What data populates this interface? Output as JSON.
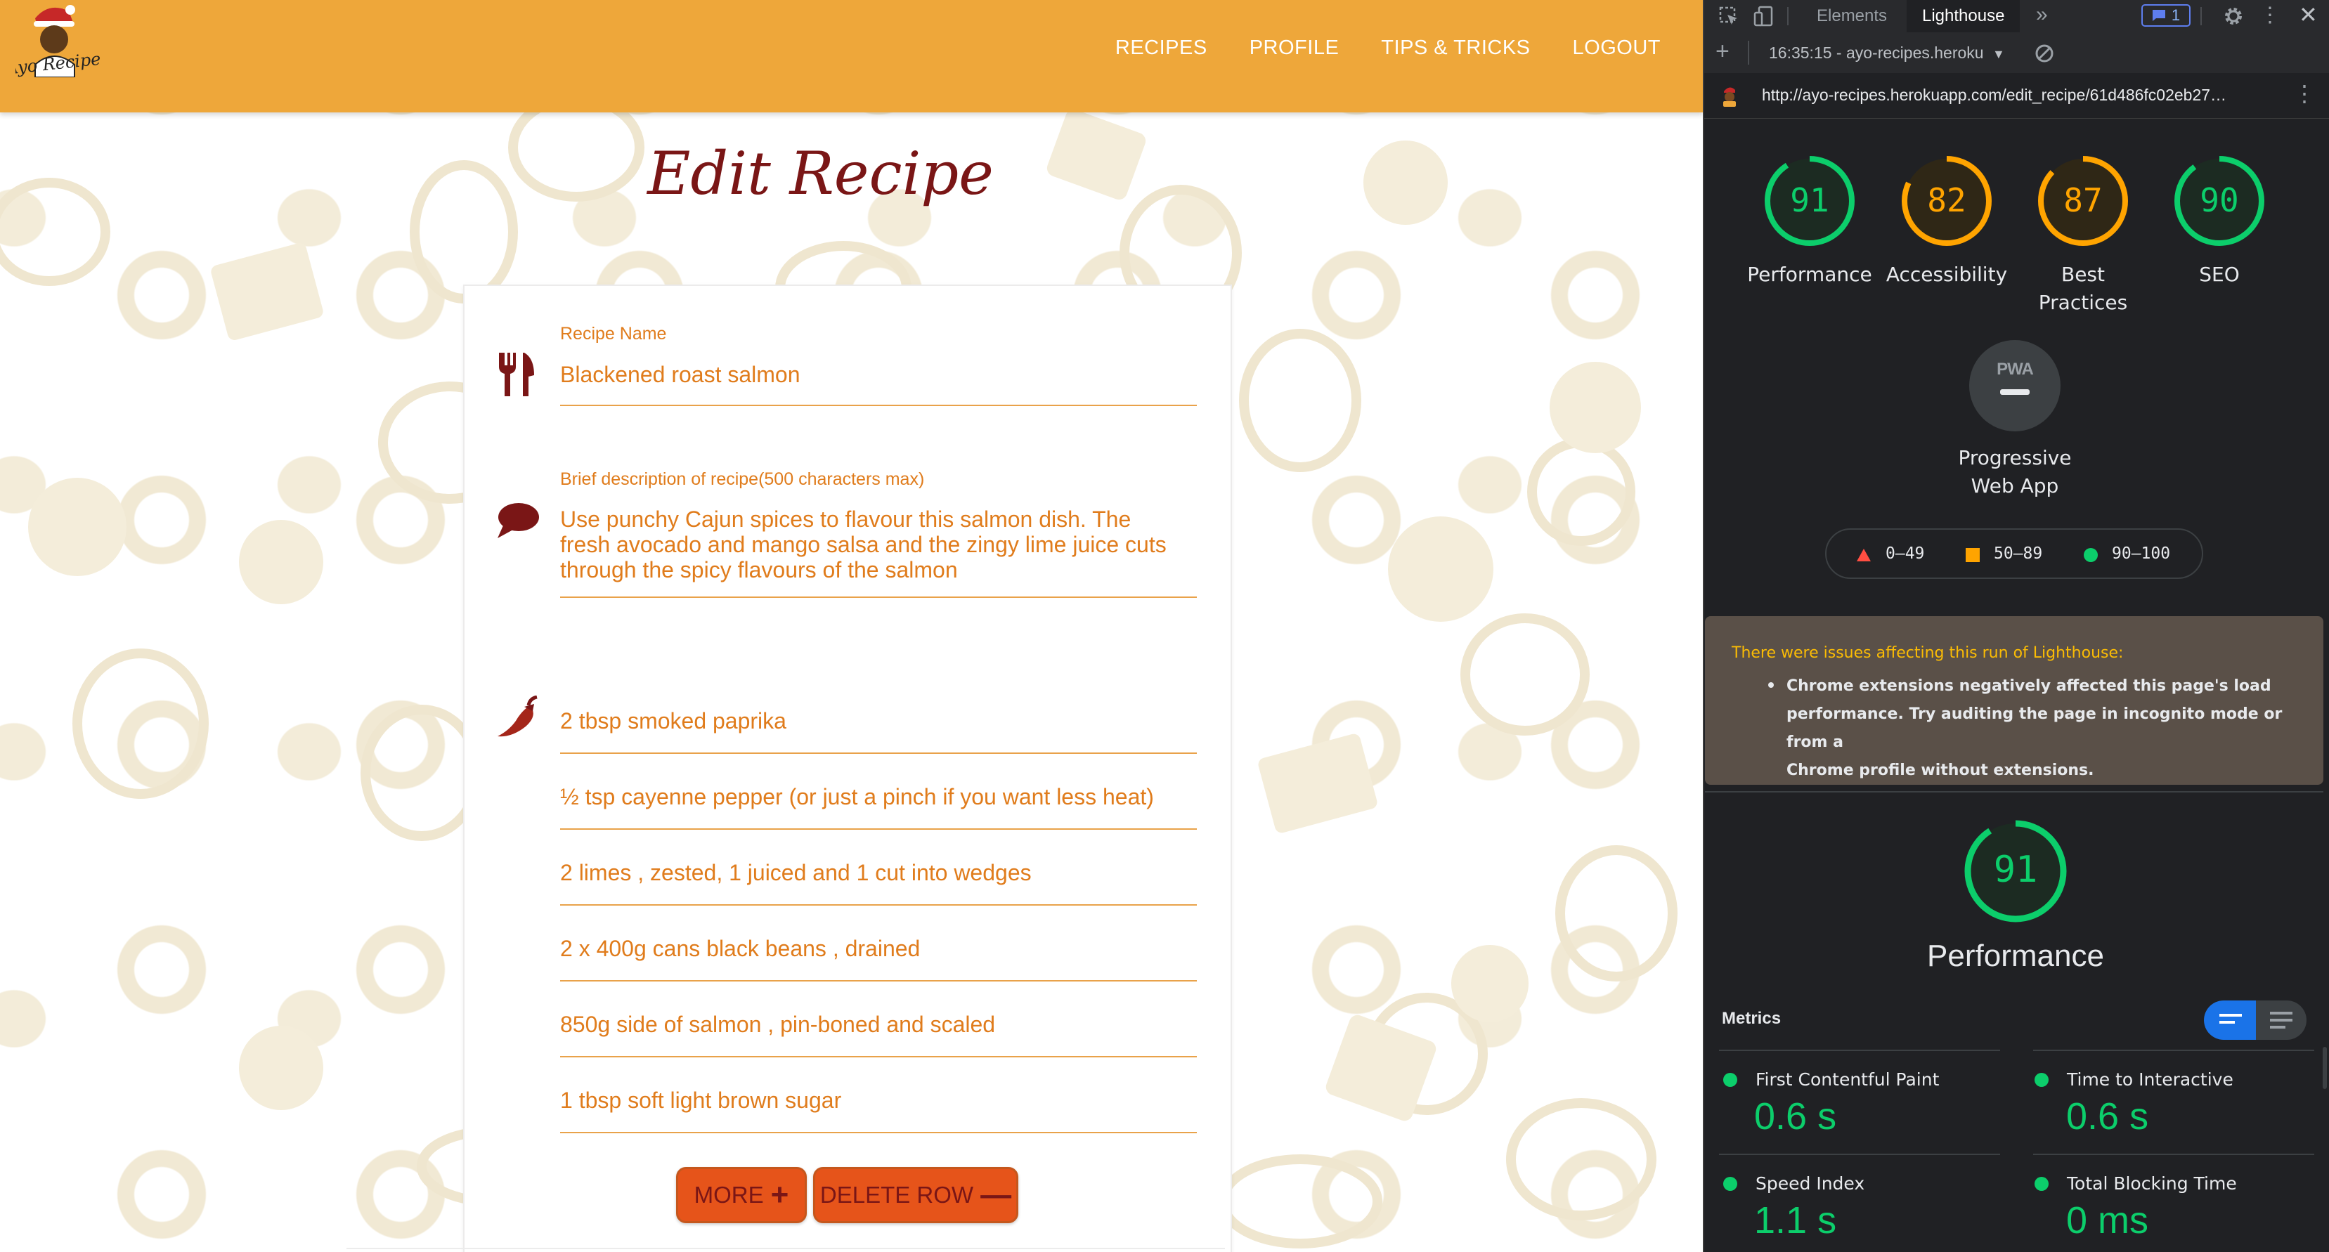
{
  "app": {
    "logo_text": "Ayo Recipes",
    "nav": [
      "RECIPES",
      "PROFILE",
      "TIPS & TRICKS",
      "LOGOUT"
    ],
    "page_title": "Edit Recipe",
    "form": {
      "recipe_name_label": "Recipe Name",
      "recipe_name_value": "Blackened roast salmon",
      "description_label": "Brief description of recipe(500 characters max)",
      "description_lines": [
        "Use punchy Cajun spices to flavour this salmon dish. The",
        "fresh avocado and mango salsa and the zingy lime juice cuts",
        "through the spicy flavours of the salmon"
      ],
      "ingredients": [
        "2 tbsp smoked paprika",
        "½ tsp cayenne pepper (or just a pinch if you want less heat)",
        "2 limes , zested, 1 juiced and 1 cut into wedges",
        "2 x 400g cans black beans , drained",
        "850g side of salmon , pin-boned and scaled",
        "1 tbsp soft light brown sugar"
      ],
      "more_button": "MORE",
      "delete_button": "DELETE ROW"
    }
  },
  "devtools": {
    "tabs": [
      "Elements",
      "Lighthouse"
    ],
    "active_tab": "Lighthouse",
    "issues_count": "1",
    "report_selector": "16:35:15 - ayo-recipes.heroku",
    "url": "http://ayo-recipes.herokuapp.com/edit_recipe/61d486fc02eb27…",
    "scores": [
      {
        "value": 91,
        "label_lines": [
          "Performance"
        ],
        "color": "#0cce6b"
      },
      {
        "value": 82,
        "label_lines": [
          "Accessibility"
        ],
        "color": "#ffa400"
      },
      {
        "value": 87,
        "label_lines": [
          "Best",
          "Practices"
        ],
        "color": "#ffa400"
      },
      {
        "value": 90,
        "label_lines": [
          "SEO"
        ],
        "color": "#0cce6b"
      }
    ],
    "pwa": {
      "badge": "PWA",
      "label_lines": [
        "Progressive",
        "Web App"
      ]
    },
    "legend": [
      {
        "range": "0–49",
        "color": "#ff4e42",
        "shape": "triangle"
      },
      {
        "range": "50–89",
        "color": "#ffa400",
        "shape": "square"
      },
      {
        "range": "90–100",
        "color": "#0cce6b",
        "shape": "circle"
      }
    ],
    "warning": {
      "title": "There were issues affecting this run of Lighthouse:",
      "lines": [
        "Chrome extensions negatively affected this page's load",
        "performance. Try auditing the page in incognito mode or from a",
        "Chrome profile without extensions."
      ]
    },
    "performance": {
      "value": 91,
      "label": "Performance",
      "color": "#0cce6b"
    },
    "metrics_title": "Metrics",
    "metrics": [
      {
        "name": "First Contentful Paint",
        "value": "0.6 s"
      },
      {
        "name": "Time to Interactive",
        "value": "0.6 s"
      },
      {
        "name": "Speed Index",
        "value": "1.1 s"
      },
      {
        "name": "Total Blocking Time",
        "value": "0 ms"
      }
    ]
  }
}
